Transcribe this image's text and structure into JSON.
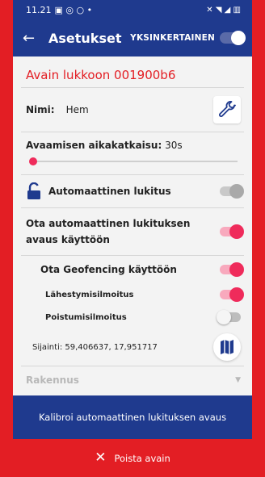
{
  "statusbar": {
    "time": "11.21",
    "icons_left": "▣ ◎ ○ •",
    "icons_right": "✕ ◥ ◢ ▥"
  },
  "appbar": {
    "title": "Asetukset",
    "simple_mode_label": "YKSINKERTAINEN",
    "simple_mode_on": true
  },
  "lock_title": "Avain lukkoon 001900b6",
  "name": {
    "label": "Nimi:",
    "value": "Hem"
  },
  "delay": {
    "label": "Avaamisen aikakatkaisu:",
    "value": "30s",
    "slider_fraction": 0.0
  },
  "autolock": {
    "label": "Automaattinen lukitus",
    "state": "disabled"
  },
  "auto_unlock": {
    "label": "Ota automaattinen lukituksen avaus käyttöön",
    "enabled": true
  },
  "geofencing": {
    "label": "Ota Geofencing käyttöön",
    "enabled": true,
    "approach": {
      "label": "Lähestymisilmoitus",
      "enabled": true
    },
    "leave": {
      "label": "Poistumisilmoitus",
      "enabled": false
    }
  },
  "location": {
    "label": "Sijainti: 59,406637, 17,951717"
  },
  "building": {
    "label": "Rakennus"
  },
  "buttons": {
    "calibrate": "Kalibroi automaattinen lukituksen avaus",
    "delete": "Poista avain"
  },
  "colors": {
    "primary_blue": "#1f3a8e",
    "accent_red": "#e31e24",
    "toggle_pink": "#ef2b5b"
  }
}
